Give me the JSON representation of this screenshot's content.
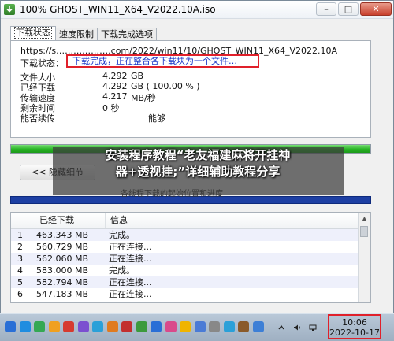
{
  "window": {
    "title": "100% GHOST_WIN11_X64_V2022.10A.iso",
    "buttons": {
      "minimize": "–",
      "maximize": "□",
      "close": "✕"
    }
  },
  "tabs": [
    {
      "label": "下载状态",
      "active": true
    },
    {
      "label": "速度限制",
      "active": false
    },
    {
      "label": "下载完成选项",
      "active": false
    }
  ],
  "details": {
    "url": "https://s……………….com/2022/win11/10/GHOST_WIN11_X64_V2022.10A",
    "status_label": "下载状态：",
    "status_value": "下载完成，正在整合各下载块为一个文件…",
    "rows": [
      {
        "label": "文件大小",
        "value": "4.292",
        "unit": "GB"
      },
      {
        "label": "已经下载",
        "value": "4.292",
        "unit": "GB  ( 100.00 % )"
      },
      {
        "label": "传输速度",
        "value": "4.217",
        "unit": "MB/秒"
      },
      {
        "label": "剩余时间",
        "value": "0 秒",
        "unit": ""
      },
      {
        "label": "能否续传",
        "value": "",
        "unit": "能够"
      }
    ]
  },
  "progress": {
    "fraction": 1.0,
    "color": "#27b324"
  },
  "buttons": {
    "hide_details": "<< 隐藏细节"
  },
  "segment_caption": "各线程下载的起始位置和进度",
  "overlay_caption": {
    "line1": "安装程序教程“老友福建麻将开挂神",
    "line2": "器+透视挂;”详细辅助教程分享"
  },
  "list": {
    "headers": [
      "",
      "已经下载",
      "信息"
    ],
    "rows": [
      {
        "n": "1",
        "downloaded": "463.343 MB",
        "info": "完成。"
      },
      {
        "n": "2",
        "downloaded": "560.729 MB",
        "info": "正在连接..."
      },
      {
        "n": "3",
        "downloaded": "562.060 MB",
        "info": "正在连接..."
      },
      {
        "n": "4",
        "downloaded": "583.000 MB",
        "info": "完成。"
      },
      {
        "n": "5",
        "downloaded": "582.794 MB",
        "info": "正在连接..."
      },
      {
        "n": "6",
        "downloaded": "547.183 MB",
        "info": "正在连接..."
      }
    ]
  },
  "taskbar": {
    "time": "10:06",
    "date": "2022-10-17",
    "icon_colors": [
      "#2a6fd6",
      "#1f8de0",
      "#35a853",
      "#f0a020",
      "#d63a2f",
      "#7b4fd0",
      "#2aa0d8",
      "#e07b20",
      "#c32f2f",
      "#3c9a3c",
      "#2a6fd6",
      "#d94a8b",
      "#f0b400",
      "#4a7bd6",
      "#888888",
      "#2aa0d8",
      "#8a5a2a",
      "#3d7fd6"
    ]
  }
}
